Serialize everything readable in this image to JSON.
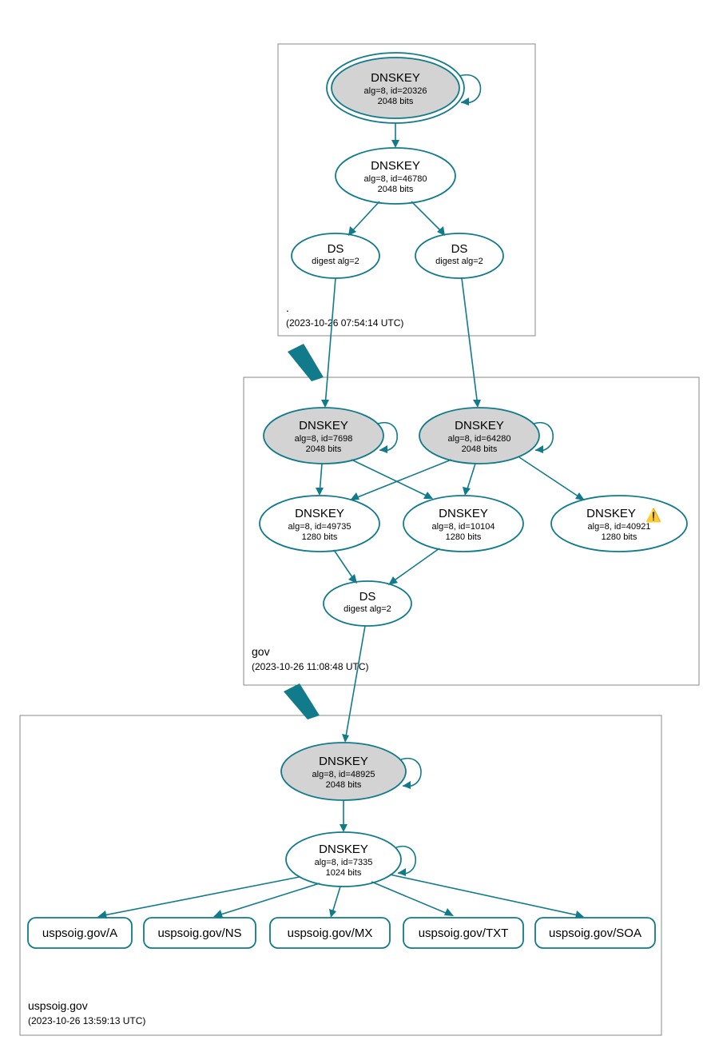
{
  "zones": {
    "root": {
      "name": ".",
      "timestamp": "(2023-10-26 07:54:14 UTC)"
    },
    "gov": {
      "name": "gov",
      "timestamp": "(2023-10-26 11:08:48 UTC)"
    },
    "leaf": {
      "name": "uspsoig.gov",
      "timestamp": "(2023-10-26 13:59:13 UTC)"
    }
  },
  "nodes": {
    "root_ksk": {
      "title": "DNSKEY",
      "line1": "alg=8, id=20326",
      "line2": "2048 bits"
    },
    "root_zsk": {
      "title": "DNSKEY",
      "line1": "alg=8, id=46780",
      "line2": "2048 bits"
    },
    "root_ds1": {
      "title": "DS",
      "line1": "digest alg=2"
    },
    "root_ds2": {
      "title": "DS",
      "line1": "digest alg=2"
    },
    "gov_ksk1": {
      "title": "DNSKEY",
      "line1": "alg=8, id=7698",
      "line2": "2048 bits"
    },
    "gov_ksk2": {
      "title": "DNSKEY",
      "line1": "alg=8, id=64280",
      "line2": "2048 bits"
    },
    "gov_zsk1": {
      "title": "DNSKEY",
      "line1": "alg=8, id=49735",
      "line2": "1280 bits"
    },
    "gov_zsk2": {
      "title": "DNSKEY",
      "line1": "alg=8, id=10104",
      "line2": "1280 bits"
    },
    "gov_zsk3": {
      "title": "DNSKEY",
      "line1": "alg=8, id=40921",
      "line2": "1280 bits",
      "warn": true
    },
    "gov_ds": {
      "title": "DS",
      "line1": "digest alg=2"
    },
    "leaf_ksk": {
      "title": "DNSKEY",
      "line1": "alg=8, id=48925",
      "line2": "2048 bits"
    },
    "leaf_zsk": {
      "title": "DNSKEY",
      "line1": "alg=8, id=7335",
      "line2": "1024 bits"
    },
    "rr_a": {
      "label": "uspsoig.gov/A"
    },
    "rr_ns": {
      "label": "uspsoig.gov/NS"
    },
    "rr_mx": {
      "label": "uspsoig.gov/MX"
    },
    "rr_txt": {
      "label": "uspsoig.gov/TXT"
    },
    "rr_soa": {
      "label": "uspsoig.gov/SOA"
    }
  }
}
